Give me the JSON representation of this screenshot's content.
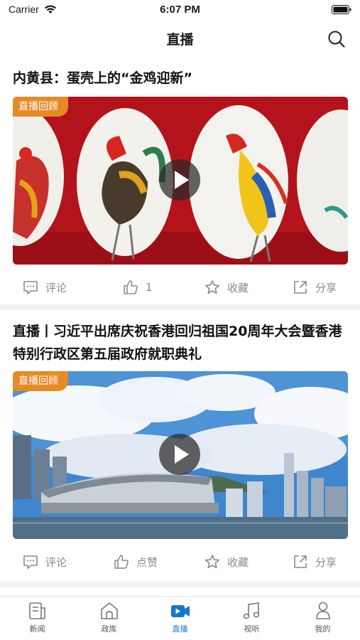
{
  "status_bar": {
    "carrier": "Carrier",
    "time": "6:07 PM"
  },
  "nav": {
    "title": "直播"
  },
  "feed": [
    {
      "title": "内黄县：蛋壳上的“金鸡迎新”",
      "badge": "直播回顾",
      "actions": {
        "comment": "评论",
        "like": "1",
        "favorite": "收藏",
        "share": "分享"
      }
    },
    {
      "title": "直播丨习近平出席庆祝香港回归祖国20周年大会暨香港特别行政区第五届政府就职典礼",
      "badge": "直播回顾",
      "actions": {
        "comment": "评论",
        "like": "点赞",
        "favorite": "收藏",
        "share": "分享"
      }
    }
  ],
  "tab_bar": {
    "items": [
      {
        "label": "新闻",
        "icon": "news-icon"
      },
      {
        "label": "政库",
        "icon": "library-icon"
      },
      {
        "label": "直播",
        "icon": "live-video-icon"
      },
      {
        "label": "视听",
        "icon": "music-icon"
      },
      {
        "label": "我的",
        "icon": "profile-icon"
      }
    ],
    "active": "直播"
  },
  "colors": {
    "accent": "#1677d2",
    "badge": "#e58b25",
    "icon_gray": "#8a8a8a"
  }
}
